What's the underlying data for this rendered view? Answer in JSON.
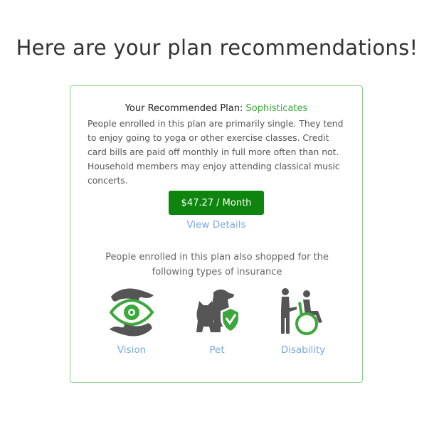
{
  "page": {
    "title": "Here are your plan recommendations!"
  },
  "recommendation": {
    "heading_prefix": "Your Recommended Plan: ",
    "plan_name": "Sophisticates",
    "description": "People enrolled in this plan are primarily single. They tend to enjoy going to yoga or other exercise classes. Credit card bills are paid off monthly in full more often than not. Household members may enjoy attending classical music concerts.",
    "price_label": "$47.27 / Month",
    "view_details_label": "View Details"
  },
  "also_shopped": {
    "text": "People enrolled in this plan also shopped for the following types of insurance",
    "items": [
      {
        "label": "Vision",
        "icon": "vision-icon"
      },
      {
        "label": "Pet",
        "icon": "pet-icon"
      },
      {
        "label": "Disability",
        "icon": "disability-icon"
      }
    ]
  },
  "colors": {
    "accent_green": "#3aa83a",
    "button_green": "#0e850e",
    "card_border": "#8fd38f",
    "link_blue": "#7aa7e0",
    "icon_gray": "#555555"
  }
}
